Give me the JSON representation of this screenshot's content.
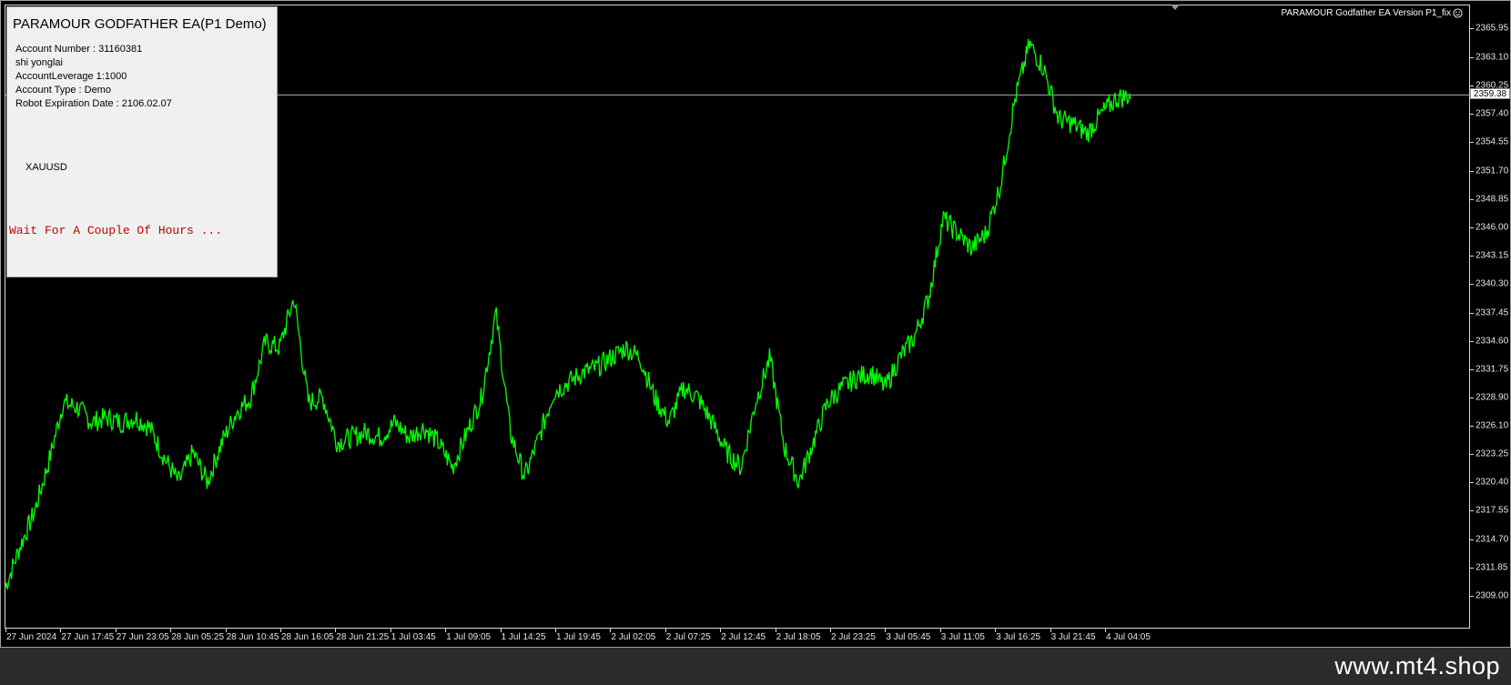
{
  "panel": {
    "title": "PARAMOUR GODFATHER EA(P1 Demo)",
    "account_number": "Account Number : 31160381",
    "name": "shi yonglai",
    "leverage": "AccountLeverage 1:1000",
    "account_type": "Account Type : Demo",
    "expiration": "Robot Expiration Date : 2106.02.07",
    "symbol": "XAUUSD",
    "status": "Wait For A Couple Of Hours ..."
  },
  "ea_version": "PARAMOUR Godfather EA Version P1_fix",
  "current_price": "2359.38",
  "watermark": "www.mt4.shop",
  "colors": {
    "background": "#000000",
    "price_line": "#00ff00",
    "status_text": "#c00000",
    "panel_bg": "#f0f0f0"
  },
  "icons": {
    "version_icon": "smiley-icon",
    "shift_marker": "chart-shift-triangle"
  },
  "chart_data": {
    "type": "line",
    "symbol": "XAUUSD",
    "ylim": [
      2309.0,
      2367.0
    ],
    "y_ticks": [
      "2365.95",
      "2363.10",
      "2360.25",
      "2357.40",
      "2354.55",
      "2351.70",
      "2348.85",
      "2346.00",
      "2343.15",
      "2340.30",
      "2337.45",
      "2334.60",
      "2331.75",
      "2328.90",
      "2326.10",
      "2323.25",
      "2320.40",
      "2317.55",
      "2314.70",
      "2311.85",
      "2309.00"
    ],
    "x_ticks": [
      "27 Jun 2024",
      "27 Jun 17:45",
      "27 Jun 23:05",
      "28 Jun 05:25",
      "28 Jun 10:45",
      "28 Jun 16:05",
      "28 Jun 21:25",
      "1 Jul 03:45",
      "1 Jul 09:05",
      "1 Jul 14:25",
      "1 Jul 19:45",
      "2 Jul 02:05",
      "2 Jul 07:25",
      "2 Jul 12:45",
      "2 Jul 18:05",
      "2 Jul 23:25",
      "3 Jul 05:45",
      "3 Jul 11:05",
      "3 Jul 16:25",
      "3 Jul 21:45",
      "4 Jul 04:05"
    ],
    "current_price": 2359.38,
    "series": [
      {
        "values": [
          2310.0,
          2314.0,
          2317.5,
          2322.5,
          2328.5,
          2328.0,
          2326.5,
          2327.0,
          2326.5,
          2327.0,
          2326.0,
          2323.0,
          2320.5,
          2323.5,
          2320.5,
          2324.5,
          2327.5,
          2329.0,
          2334.5,
          2334.0,
          2339.0,
          2328.5,
          2329.0,
          2324.5,
          2325.0,
          2325.5,
          2325.0,
          2326.5,
          2325.0,
          2326.0,
          2324.5,
          2322.0,
          2325.5,
          2329.0,
          2337.5,
          2325.5,
          2321.0,
          2325.0,
          2329.5,
          2330.5,
          2331.5,
          2332.0,
          2333.0,
          2334.0,
          2333.0,
          2329.0,
          2326.5,
          2330.0,
          2329.0,
          2326.5,
          2323.5,
          2322.0,
          2328.5,
          2333.0,
          2324.0,
          2320.5,
          2324.5,
          2328.5,
          2330.0,
          2331.0,
          2331.5,
          2330.0,
          2333.0,
          2335.0,
          2339.0,
          2347.0,
          2345.5,
          2344.0,
          2345.5,
          2350.5,
          2359.0,
          2364.5,
          2362.0,
          2357.0,
          2356.5,
          2355.5,
          2357.5,
          2359.0,
          2359.38
        ],
        "x_range": [
          0.0,
          1.0
        ]
      }
    ]
  }
}
